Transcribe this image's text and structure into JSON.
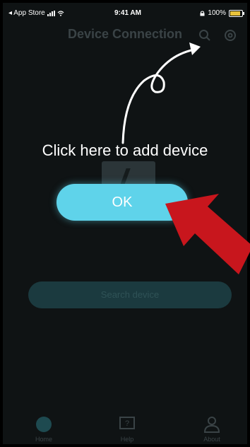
{
  "status_bar": {
    "carrier": "◂ App Store",
    "time": "9:41 AM",
    "battery_percent": "100%"
  },
  "header": {
    "title": "Device Connection",
    "search_icon": "search-icon",
    "settings_icon": "gear-icon"
  },
  "overlay": {
    "hint": "Click here to add device",
    "ok_label": "OK"
  },
  "main": {
    "search_device_label": "Search device"
  },
  "tabs": [
    {
      "label": "Home",
      "icon": "home-icon"
    },
    {
      "label": "Help",
      "icon": "help-icon"
    },
    {
      "label": "About",
      "icon": "profile-icon"
    }
  ],
  "colors": {
    "ok_button": "#5fd3ea",
    "red_arrow": "#c8161d",
    "battery_fill": "#e8c23a"
  }
}
